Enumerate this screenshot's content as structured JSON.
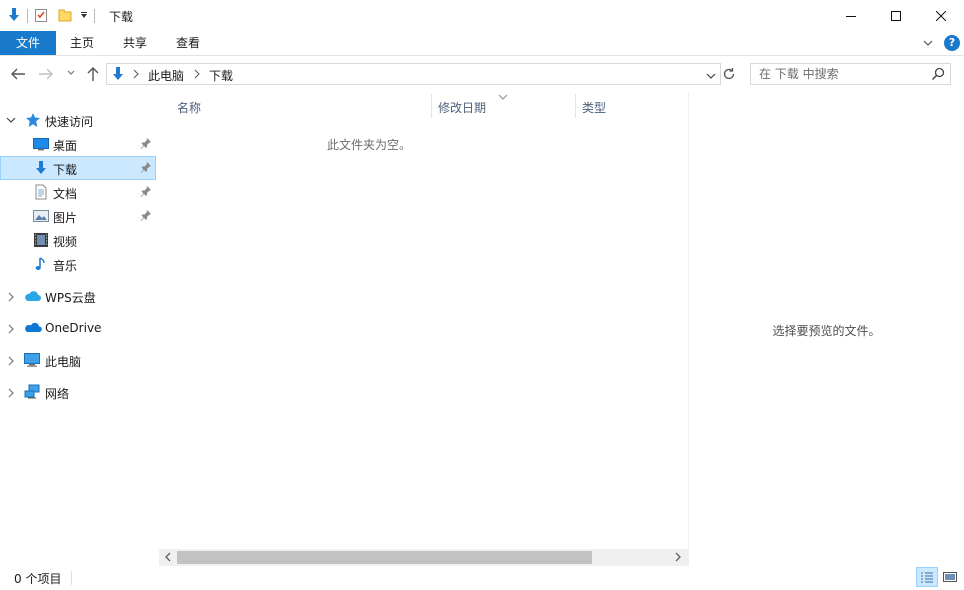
{
  "window": {
    "title": "下载",
    "controls": [
      "minimize",
      "maximize",
      "close"
    ]
  },
  "ribbon": {
    "tabs": [
      "文件",
      "主页",
      "共享",
      "查看"
    ],
    "help": "?"
  },
  "address": {
    "crumbs": [
      "此电脑",
      "下载"
    ]
  },
  "search": {
    "placeholder": "在 下载 中搜索"
  },
  "navpane": {
    "quick_access": "快速访问",
    "quick_items": [
      {
        "label": "桌面",
        "icon": "desktop-icon",
        "pinned": true
      },
      {
        "label": "下载",
        "icon": "download-icon",
        "pinned": true
      },
      {
        "label": "文档",
        "icon": "document-icon",
        "pinned": true
      },
      {
        "label": "图片",
        "icon": "picture-icon",
        "pinned": true
      },
      {
        "label": "视频",
        "icon": "video-icon",
        "pinned": false
      },
      {
        "label": "音乐",
        "icon": "music-icon",
        "pinned": false
      }
    ],
    "roots": [
      {
        "label": "WPS云盘",
        "icon": "wps-cloud-icon"
      },
      {
        "label": "OneDrive",
        "icon": "onedrive-icon"
      },
      {
        "label": "此电脑",
        "icon": "this-pc-icon"
      },
      {
        "label": "网络",
        "icon": "network-icon"
      }
    ]
  },
  "content": {
    "columns": [
      "名称",
      "修改日期",
      "类型"
    ],
    "empty_message": "此文件夹为空。"
  },
  "preview": {
    "message": "选择要预览的文件。"
  },
  "status": {
    "item_count": "0 个项目"
  },
  "colors": {
    "accent": "#1979ca",
    "selection": "#cce8ff"
  }
}
